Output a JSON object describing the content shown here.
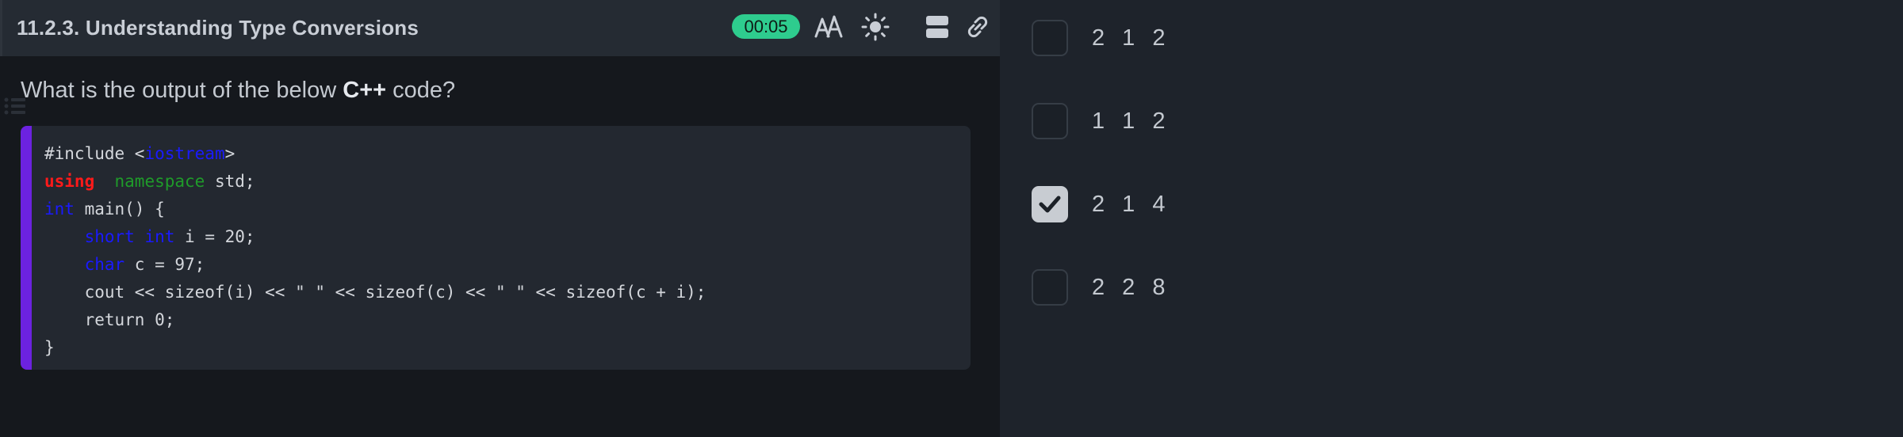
{
  "header": {
    "title": "11.2.3. Understanding Type Conversions",
    "timer": "00:05",
    "icons": [
      "font-size-icon",
      "brightness-icon",
      "layout-icon",
      "link-icon"
    ]
  },
  "question": {
    "prefix": "What is the output of the below ",
    "language": "C++",
    "suffix": " code?"
  },
  "code": {
    "l1_a": "#include <",
    "l1_b": "iostream",
    "l1_c": ">",
    "l2_a": "using",
    "l2_b": "namespace",
    "l2_c": " std;",
    "l3_a": "int",
    "l3_b": " main() {",
    "l4_a": "short",
    "l4_b": "int",
    "l4_c": " i = 20;",
    "l5_a": "char",
    "l5_b": " c = 97;",
    "l6": "    cout << sizeof(i) << \" \" << sizeof(c) << \" \" << sizeof(c + i);",
    "l7": "    return 0;",
    "l8": "}"
  },
  "options": [
    {
      "label": "2 1 2",
      "checked": false
    },
    {
      "label": "1 1 2",
      "checked": false
    },
    {
      "label": "2 1 4",
      "checked": true
    },
    {
      "label": "2 2 8",
      "checked": false
    }
  ],
  "colors": {
    "accent_bar": "#6c22e0",
    "timer_bg": "#2ecc8e",
    "keyword_red": "#ff1a1a",
    "keyword_green": "#1f9b2a",
    "keyword_blue": "#1a1aff"
  }
}
